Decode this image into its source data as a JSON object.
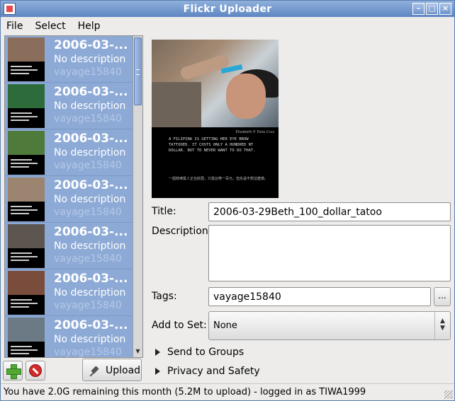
{
  "window": {
    "title": "Flickr Uploader"
  },
  "menu": {
    "file": "File",
    "select": "Select",
    "help": "Help"
  },
  "photos": [
    {
      "date": "2006-03-...",
      "description": "No description",
      "tags": "vayage15840",
      "thumb_color": "#8a6d5b"
    },
    {
      "date": "2006-03-...",
      "description": "No description",
      "tags": "vayage15840",
      "thumb_color": "#2e6b3a"
    },
    {
      "date": "2006-03-...",
      "description": "No description",
      "tags": "vayage15840",
      "thumb_color": "#4f7a3c"
    },
    {
      "date": "2006-03-...",
      "description": "No description",
      "tags": "vayage15840",
      "thumb_color": "#9b8570"
    },
    {
      "date": "2006-03-...",
      "description": "No description",
      "tags": "vayage15840",
      "thumb_color": "#5c5550"
    },
    {
      "date": "2006-03-...",
      "description": "No description",
      "tags": "vayage15840",
      "thumb_color": "#7a4c3c"
    },
    {
      "date": "2006-03-...",
      "description": "No description",
      "tags": "vayage15840",
      "thumb_color": "#6b7a85"
    }
  ],
  "buttons": {
    "upload": "Upload"
  },
  "preview": {
    "credit": "Elizabeth P. Dela Cruz",
    "caption": "A FILIPINA IS GETTING HER EYE BROW TATTOOED. IT COSTS ONLY A HUNDRED NT DOLLAR. BUT TO NEVER WANT TO DO THAT.",
    "caption_cn": "一個菲律賓人正在紋眉，只需台幣一百元，但永遠不想這麼做。"
  },
  "form": {
    "title_label": "Title:",
    "title_value": "2006-03-29Beth_100_dollar_tatoo",
    "description_label": "Description:",
    "description_value": "",
    "tags_label": "Tags:",
    "tags_value": "vayage15840",
    "tags_more": "...",
    "set_label": "Add to Set:",
    "set_value": "None",
    "groups_label": "Send to Groups",
    "privacy_label": "Privacy and Safety"
  },
  "status": {
    "text": "You have 2.0G remaining this month (5.2M to upload) - logged in as TIWA1999"
  }
}
